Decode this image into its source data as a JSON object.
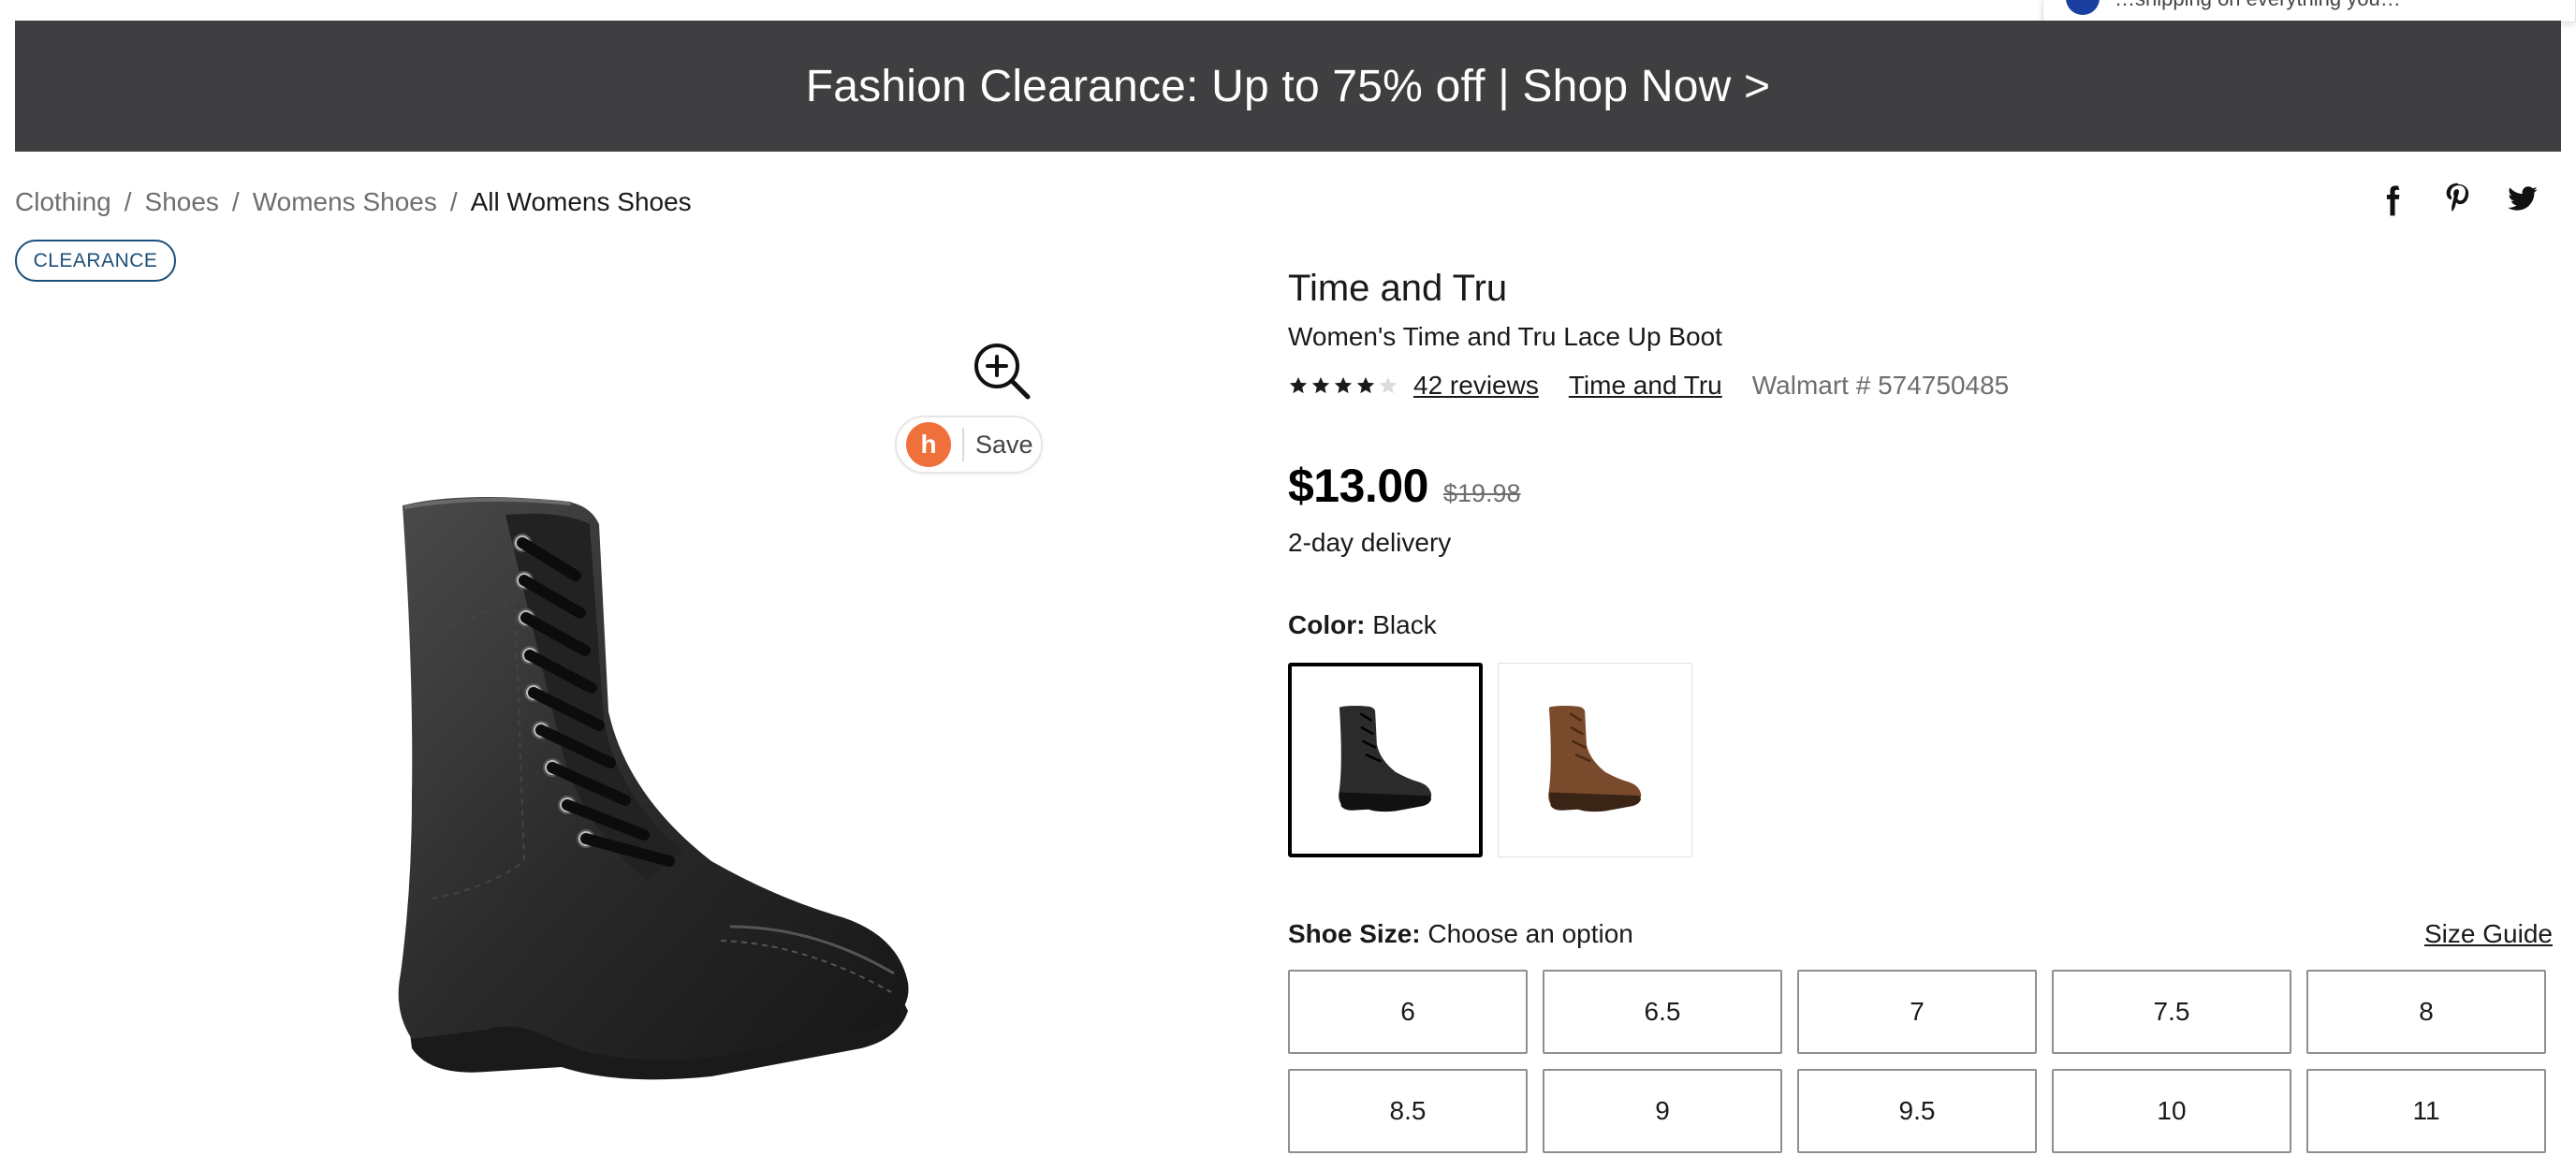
{
  "popup": {
    "text": "…shipping on everything you…"
  },
  "banner": {
    "text": "Fashion Clearance: Up to 75% off | Shop Now >"
  },
  "breadcrumb": {
    "items": [
      "Clothing",
      "Shoes",
      "Womens Shoes",
      "All Womens Shoes"
    ],
    "separator": "/"
  },
  "social": {
    "icons": [
      "facebook-icon",
      "pinterest-icon",
      "twitter-icon"
    ]
  },
  "badge": {
    "label": "CLEARANCE"
  },
  "save_pill": {
    "honey_glyph": "h",
    "label": "Save"
  },
  "product": {
    "brand": "Time and Tru",
    "name": "Women's Time and Tru Lace Up Boot",
    "rating": {
      "value": 4,
      "max": 5
    },
    "reviews_link": "42 reviews",
    "brand_link": "Time and Tru",
    "item_number": "Walmart # 574750485",
    "price": "$13.00",
    "was_price": "$19.98",
    "delivery": "2-day delivery"
  },
  "color": {
    "label": "Color:",
    "selected": "Black",
    "options": [
      {
        "name": "Black",
        "hex": "#2b2b2b",
        "selected": true
      },
      {
        "name": "Brown",
        "hex": "#7a4a2c",
        "selected": false
      }
    ]
  },
  "size": {
    "label": "Shoe Size:",
    "placeholder": "Choose an option",
    "guide_link": "Size Guide",
    "options": [
      "6",
      "6.5",
      "7",
      "7.5",
      "8",
      "8.5",
      "9",
      "9.5",
      "10",
      "11"
    ]
  },
  "colors": {
    "banner_bg": "#3f3f41",
    "badge": "#1d4f7a",
    "honey": "#f0703b",
    "muted_text": "#6d6e71"
  }
}
